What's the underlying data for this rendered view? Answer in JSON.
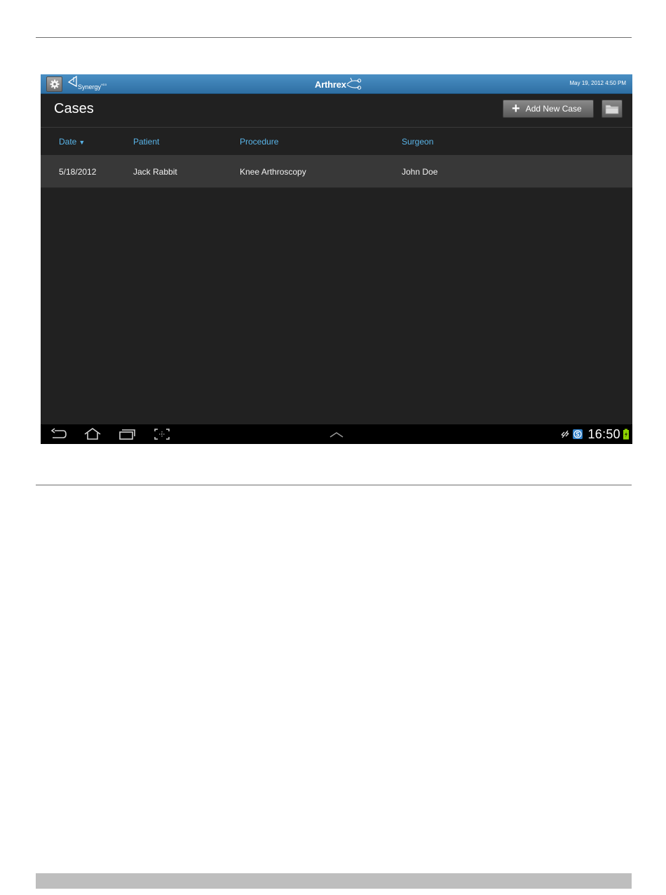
{
  "app": {
    "brand_left": "Synergy",
    "brand_left_mark": "HD3",
    "brand_center": "Arthrex",
    "datetime": "May 19, 2012   4:50 PM"
  },
  "header": {
    "title": "Cases",
    "add_button_label": "Add New Case"
  },
  "table": {
    "columns": [
      {
        "label": "Date"
      },
      {
        "label": "Patient"
      },
      {
        "label": "Procedure"
      },
      {
        "label": "Surgeon"
      }
    ],
    "sort_indicator": "▼",
    "rows": [
      {
        "date": "5/18/2012",
        "patient": "Jack Rabbit",
        "procedure": "Knee Arthroscopy",
        "surgeon": "John Doe"
      }
    ]
  },
  "system_bar": {
    "clock": "16:50",
    "icons": [
      "back-icon",
      "home-icon",
      "recent-apps-icon",
      "screenshot-icon",
      "up-chevron-icon",
      "sync-icon",
      "s-app-icon",
      "battery-charging-icon"
    ]
  },
  "colors": {
    "app_bar": "#3a7fb6",
    "column_header_text": "#59b4e8",
    "background": "#212121",
    "row_background": "#383838",
    "battery": "#8fd400"
  }
}
